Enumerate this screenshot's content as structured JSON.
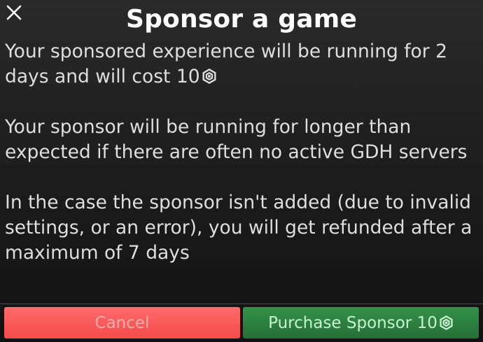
{
  "dialog": {
    "title": "Sponsor a game",
    "close_icon": "close-icon",
    "paragraphs": [
      "Your sponsored experience will be running for 2 days and will cost 10",
      "Your sponsor will be running for longer than expected if there are often no active GDH servers",
      "In the case the sponsor isn't added (due to invalid settings, or an error), you will get refunded after a maximum of 7 days"
    ],
    "currency_icon": "robux-icon"
  },
  "buttons": {
    "cancel_label": "Cancel",
    "purchase_label": "Purchase Sponsor 10"
  },
  "colors": {
    "cancel_button": "#f55a5a",
    "purchase_button": "#2e8344",
    "title_text": "#ffffff"
  }
}
